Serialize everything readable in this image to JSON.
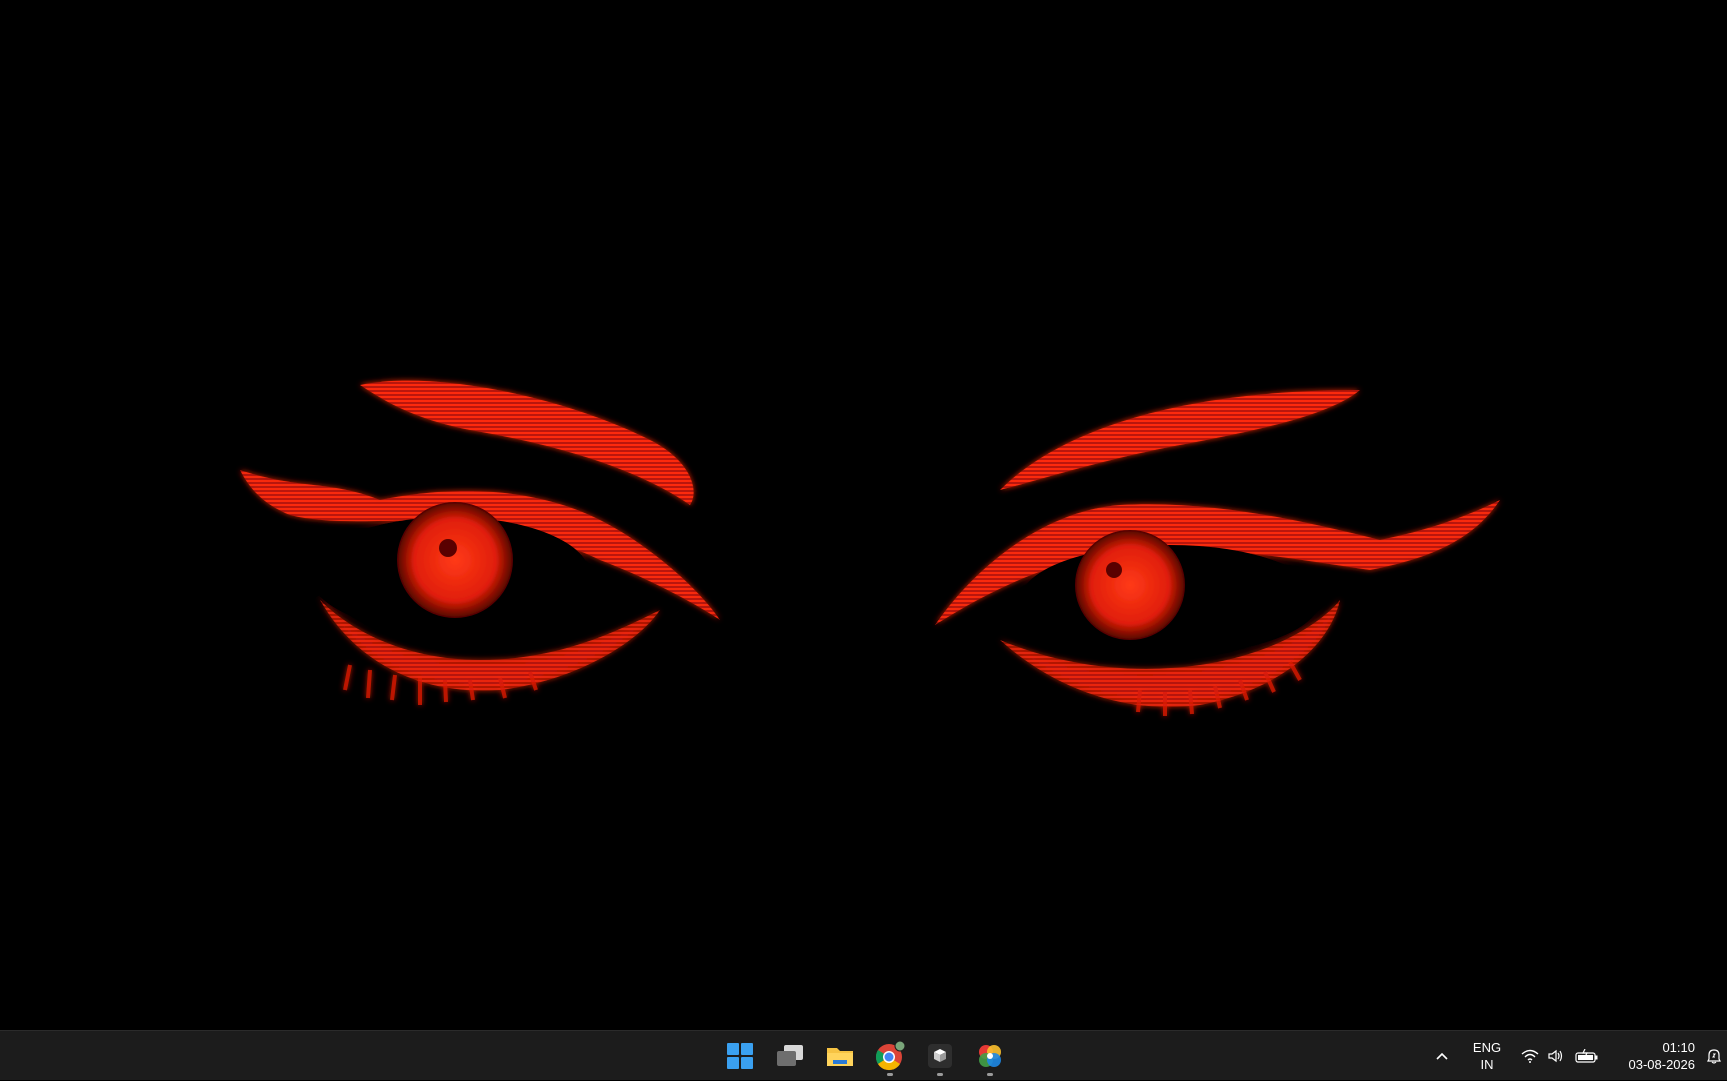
{
  "wallpaper": {
    "description_icon": "red-glowing-eyes-wallpaper",
    "colors": {
      "background": "#000000",
      "eye_red": "#ff2a10",
      "eye_dark": "#6a0800"
    }
  },
  "taskbar": {
    "apps": [
      {
        "name": "Start",
        "icon": "windows-start-icon",
        "running": false
      },
      {
        "name": "Task View",
        "icon": "task-view-icon",
        "running": false
      },
      {
        "name": "File Explorer",
        "icon": "folder-icon",
        "running": false
      },
      {
        "name": "Google Chrome",
        "icon": "chrome-icon",
        "running": true
      },
      {
        "name": "App",
        "icon": "cube-app-icon",
        "running": true
      },
      {
        "name": "App",
        "icon": "color-wheel-app-icon",
        "running": true
      }
    ],
    "tray": {
      "language_line1": "ENG",
      "language_line2": "IN",
      "time": "01:10",
      "date": "03-08-2026",
      "icons": [
        "chevron-up-icon",
        "wifi-icon",
        "volume-icon",
        "battery-icon",
        "notification-bell-icon"
      ]
    },
    "colors": {
      "background": "#1c1c1c",
      "windows_blue": "#3aa0f0",
      "folder_yellow": "#f6c343"
    }
  }
}
